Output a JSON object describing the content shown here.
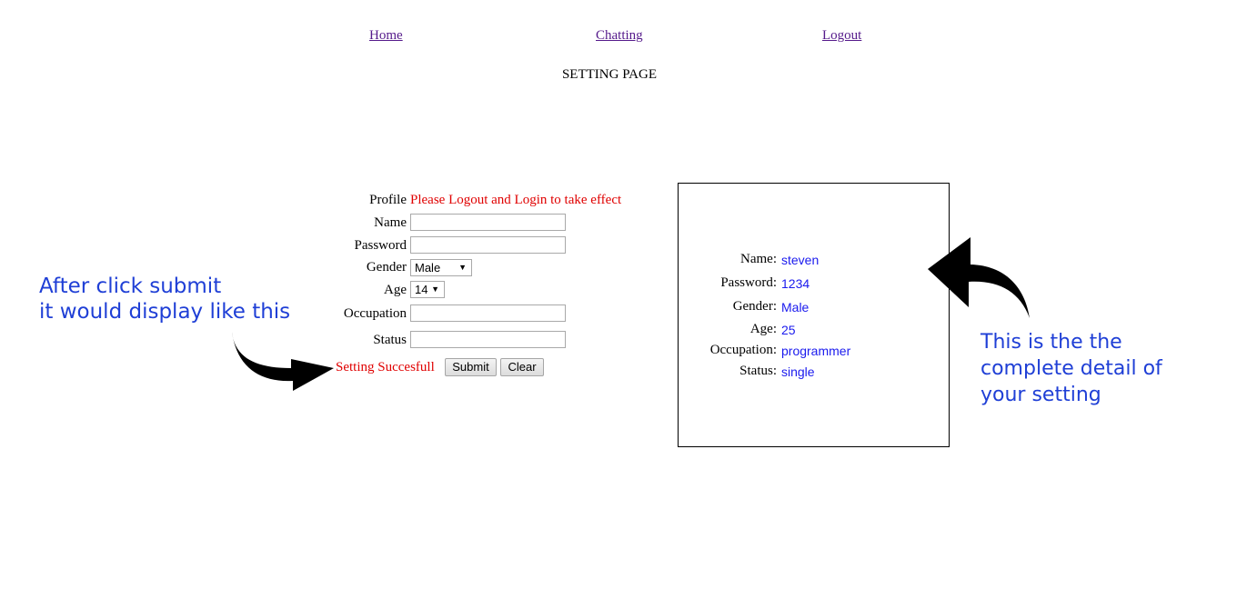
{
  "nav": {
    "home": "Home",
    "chatting": "Chatting",
    "logout": "Logout"
  },
  "page_title": "SETTING PAGE",
  "form": {
    "profile_label": "Profile",
    "profile_notice": "Please Logout and Login to take effect",
    "name_label": "Name",
    "name_value": "",
    "password_label": "Password",
    "password_value": "",
    "gender_label": "Gender",
    "gender_value": "Male",
    "age_label": "Age",
    "age_value": "14",
    "occupation_label": "Occupation",
    "occupation_value": "",
    "status_label": "Status",
    "status_value": "",
    "success_message": "Setting Succesfull",
    "submit_label": "Submit",
    "clear_label": "Clear"
  },
  "details": {
    "name_label": "Name:",
    "name_value": "steven",
    "password_label": "Password:",
    "password_value": "1234",
    "gender_label": "Gender:",
    "gender_value": "Male",
    "age_label": "Age:",
    "age_value": "25",
    "occupation_label": "Occupation:",
    "occupation_value": "programmer",
    "status_label": "Status:",
    "status_value": "single"
  },
  "annotations": {
    "left_line1": "After click submit",
    "left_line2": "it would display like this",
    "right_line1": "This is the the",
    "right_line2": "complete detail of",
    "right_line3": "your setting"
  },
  "colors": {
    "link": "#551a8b",
    "error": "#e00000",
    "value": "#1a1aee",
    "annotation": "#1f3fd6"
  }
}
